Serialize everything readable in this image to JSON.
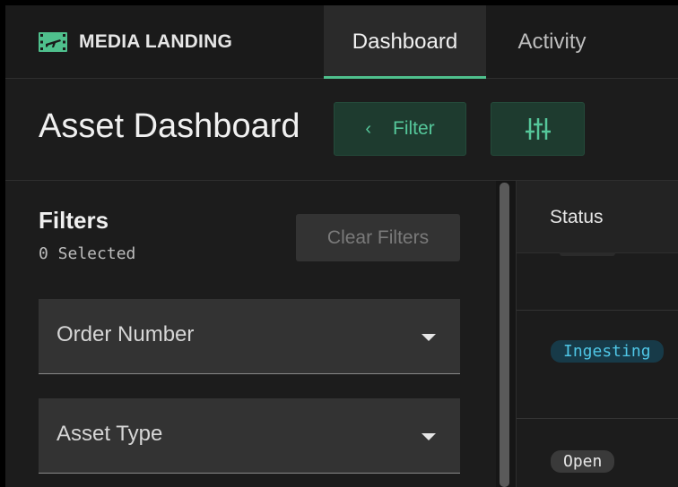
{
  "brand": {
    "name": "MEDIA LANDING",
    "icon": "film-plane-icon",
    "accent": "#4fc08d"
  },
  "nav": {
    "tabs": [
      {
        "label": "Dashboard",
        "active": true
      },
      {
        "label": "Activity",
        "active": false
      }
    ]
  },
  "header": {
    "title": "Asset Dashboard",
    "filter_button": "Filter",
    "filter_icon": "chevron-left-icon",
    "tune_icon": "tune-icon"
  },
  "filters": {
    "title": "Filters",
    "selected_count": "0 Selected",
    "clear_button": "Clear Filters",
    "fields": [
      {
        "label": "Order Number"
      },
      {
        "label": "Asset Type"
      }
    ]
  },
  "table": {
    "columns": [
      "Status"
    ],
    "rows": [
      {
        "status": ""
      },
      {
        "status": "Ingesting",
        "color": "#4fc6e6"
      },
      {
        "status": "Open"
      }
    ]
  }
}
